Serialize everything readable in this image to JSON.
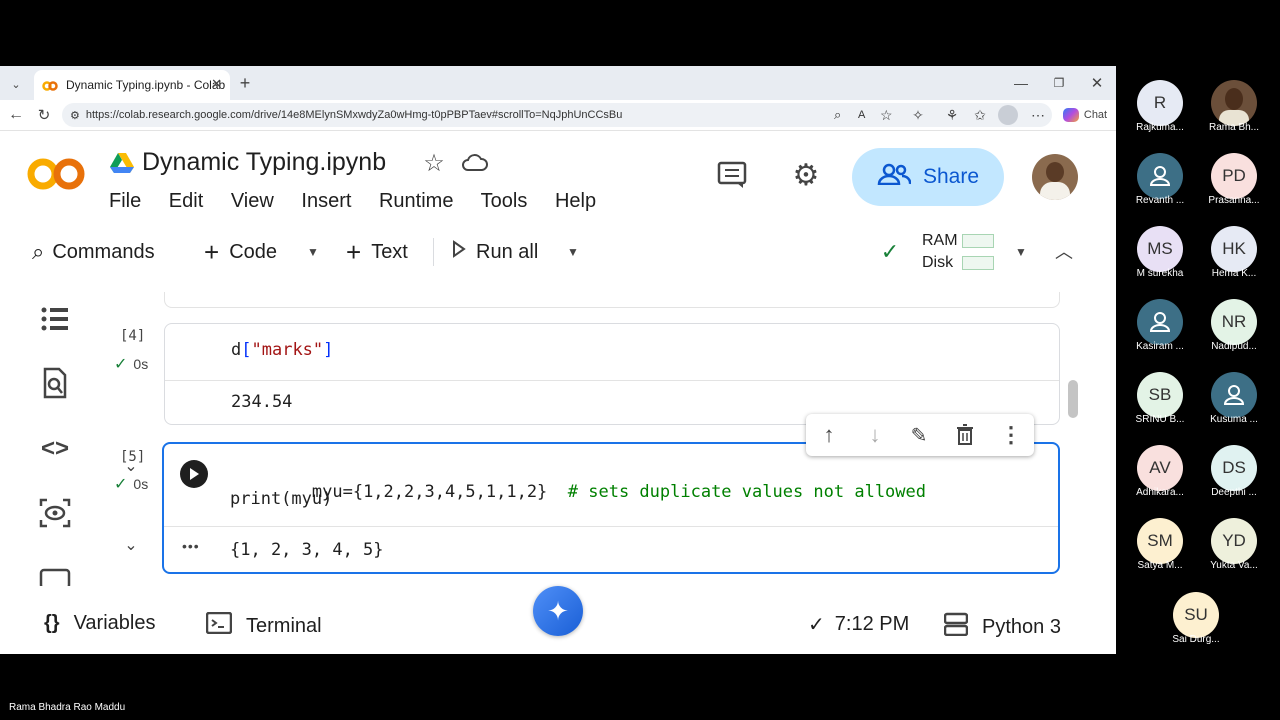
{
  "browser": {
    "tab_title": "Dynamic Typing.ipynb - Colab",
    "url": "https://colab.research.google.com/drive/14e8MElynSMxwdyZa0wHmg-t0pPBPTaev#scrollTo=NqJphUnCCsBu",
    "chat_label": "Chat",
    "new_tab_symbol": "+"
  },
  "colab": {
    "logo": "CO",
    "notebook_title": "Dynamic Typing.ipynb",
    "menu": [
      "File",
      "Edit",
      "View",
      "Insert",
      "Runtime",
      "Tools",
      "Help"
    ],
    "share_label": "Share",
    "toolbar": {
      "commands": "Commands",
      "code": "Code",
      "text": "Text",
      "run_all": "Run all",
      "ram": "RAM",
      "disk": "Disk"
    },
    "cells": [
      {
        "number": "[4]",
        "time": "0s",
        "code_parts": [
          "d",
          "[",
          "\"marks\"",
          "]"
        ],
        "output": "234.54"
      },
      {
        "number": "[5]",
        "time": "0s",
        "line1_code": "myu={1,2,2,3,4,5,1,1,2}",
        "line1_comment": "# sets duplicate values not allowed",
        "line2": "print(myu)",
        "output": "{1, 2, 3, 4, 5}",
        "ellipsis": "•••"
      }
    ],
    "statusbar": {
      "variables": "Variables",
      "terminal": "Terminal",
      "time": "7:12 PM",
      "runtime": "Python 3"
    }
  },
  "participants": [
    {
      "initials": "R",
      "name": "Rajkuma...",
      "color": "#e6eaf4"
    },
    {
      "initials": "",
      "name": "Rama Bh...",
      "color": "#6b4f3a"
    },
    {
      "initials": "",
      "name": "Revanth ...",
      "color": "#3d6f86"
    },
    {
      "initials": "PD",
      "name": "Prasanna...",
      "color": "#f9e0de"
    },
    {
      "initials": "MS",
      "name": "M surekha",
      "color": "#e8e0f5"
    },
    {
      "initials": "HK",
      "name": "Hema K...",
      "color": "#e6eaf4"
    },
    {
      "initials": "",
      "name": "Kasiram ...",
      "color": "#3d6f86"
    },
    {
      "initials": "NR",
      "name": "Nadipud...",
      "color": "#e3f3e6"
    },
    {
      "initials": "SB",
      "name": "SRINU B...",
      "color": "#e3f3e6"
    },
    {
      "initials": "",
      "name": "Kusuma ...",
      "color": "#3d6f86"
    },
    {
      "initials": "AV",
      "name": "Adhikara...",
      "color": "#f9e0de"
    },
    {
      "initials": "DS",
      "name": "Deepthi ...",
      "color": "#e0f2f1"
    },
    {
      "initials": "SM",
      "name": "Satya M...",
      "color": "#fdf0d0"
    },
    {
      "initials": "YD",
      "name": "Yukta Va...",
      "color": "#eef0dc"
    },
    {
      "initials": "SU",
      "name": "Sai Durg...",
      "color": "#fdf0d0"
    }
  ],
  "presenter_name": "Rama Bhadra Rao Maddu",
  "colors": {
    "accent": "#1a73e8",
    "share_bg": "#c2e7ff",
    "check": "#188038",
    "string": "#a31515",
    "number": "#116644",
    "comment": "#008000"
  }
}
